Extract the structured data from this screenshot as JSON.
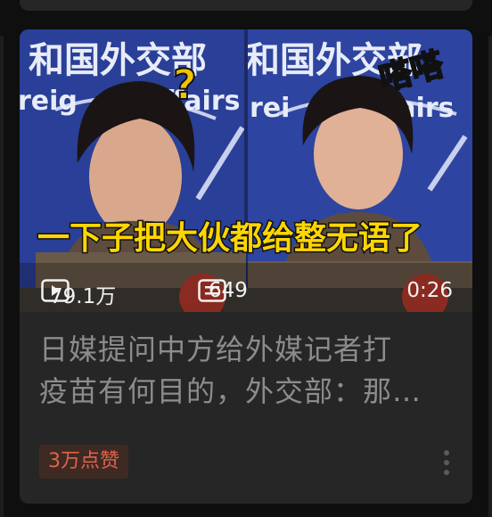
{
  "video": {
    "thumbnail": {
      "banner_text_left": "和国外交部",
      "banner_text_right": "和国外交部",
      "banner_sub_left": "reig",
      "banner_sub_right": "ffairs",
      "banner_sub_mid": "ffairs",
      "banner_sub_right2": "rei",
      "question_sticker": "?",
      "laugh_sticker": "嗒嗒",
      "caption": "一下子把大伙都给整无语了"
    },
    "views": "79.1万",
    "comments": "649",
    "duration": "0:26",
    "title_line1": "日媒提问中方给外媒记者打",
    "title_line2": "疫苗有何目的，外交部：那…",
    "likes_badge": "3万点赞"
  },
  "icons": {
    "play": "play-icon",
    "comments": "comment-icon",
    "more": "more-vertical-icon"
  },
  "colors": {
    "background": "#0f0f0f",
    "card": "#262626",
    "title": "#8c8c8c",
    "badge_bg": "#3e2a23",
    "badge_text": "#e0634b"
  }
}
